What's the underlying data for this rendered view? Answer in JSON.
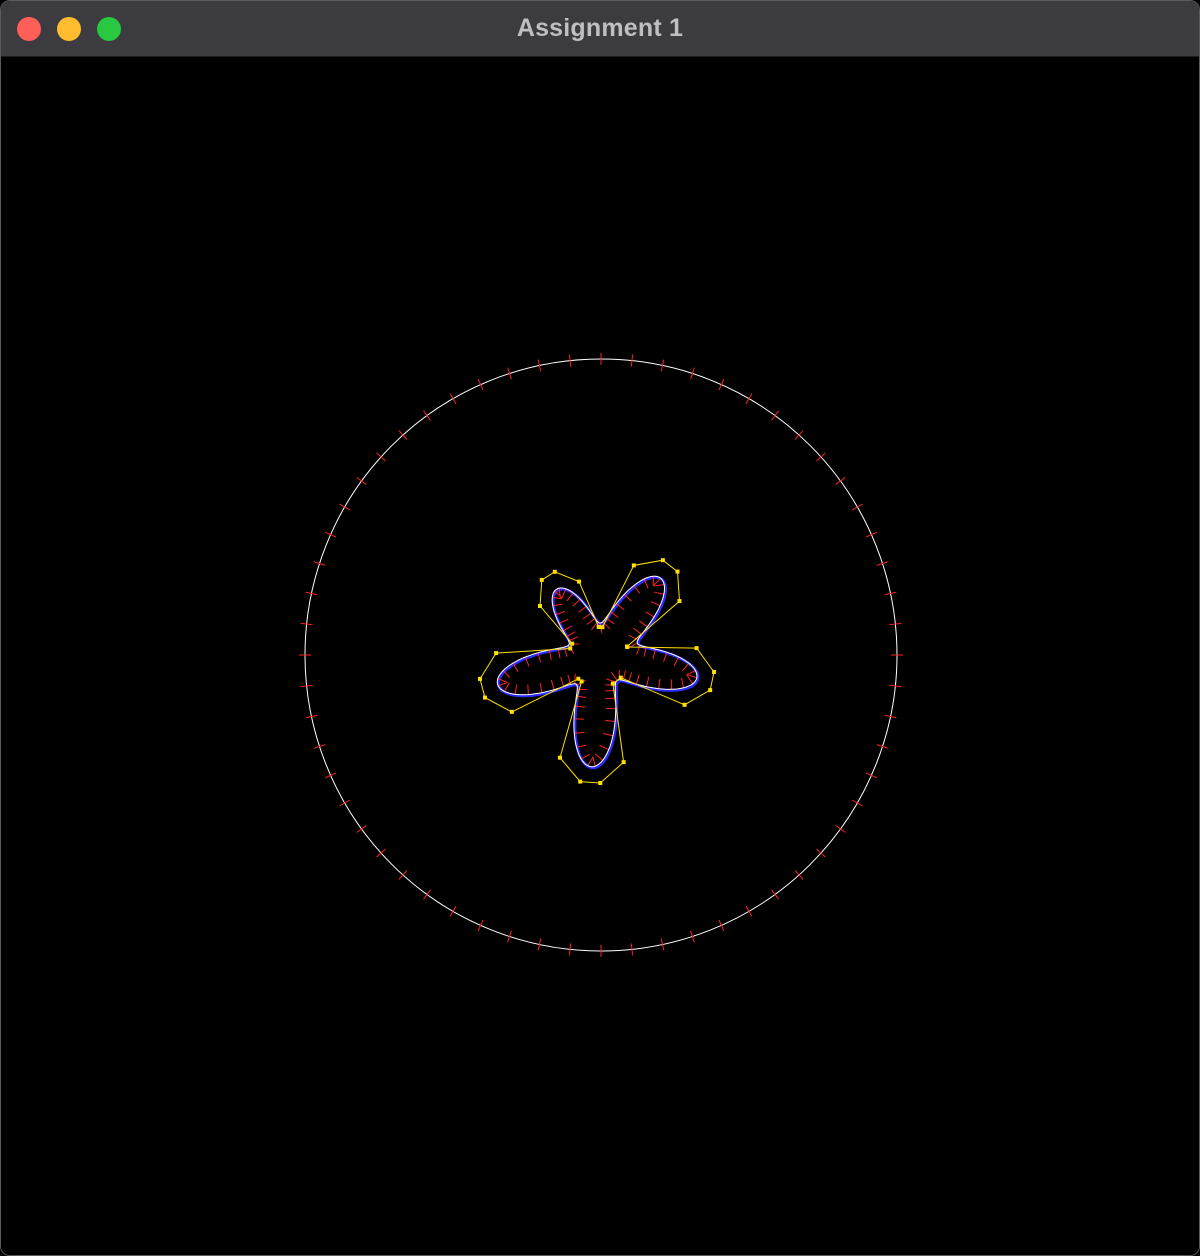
{
  "window": {
    "title": "Assignment 1",
    "buttons": {
      "close_color": "#ff5f57",
      "minimize_color": "#febc2e",
      "zoom_color": "#28c840"
    }
  },
  "scene": {
    "background": "#000000",
    "outer_circle": {
      "stroke": "#ffffff",
      "normal_color": "#ff2020",
      "normal_count": 60
    },
    "shape": {
      "petals": 5,
      "curve_color": "#ffffff",
      "fill_shadow_color": "#2a2aff",
      "control_polygon_color": "#ffe000",
      "control_point_color": "#ffe000",
      "normal_color": "#ff2020"
    }
  }
}
